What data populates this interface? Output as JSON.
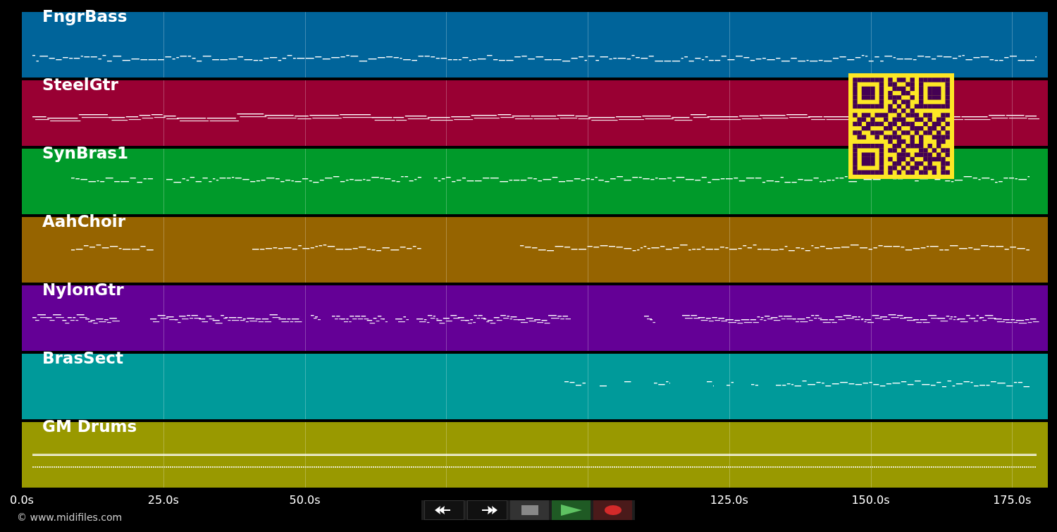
{
  "tracks": [
    {
      "name": "FngrBass",
      "color": "#00649a"
    },
    {
      "name": "SteelGtr",
      "color": "#990033"
    },
    {
      "name": "SynBras1",
      "color": "#009a2a"
    },
    {
      "name": "AahChoir",
      "color": "#966400"
    },
    {
      "name": "NylonGtr",
      "color": "#640096"
    },
    {
      "name": "BrasSect",
      "color": "#009a9a"
    },
    {
      "name": "GM Drums",
      "color": "#999900"
    }
  ],
  "time_axis": [
    "0.0s",
    "25.0s",
    "50.0s",
    "125.0s",
    "150.0s",
    "175.0s"
  ],
  "transport": [
    {
      "kind": "rewind"
    },
    {
      "kind": "fast_forward"
    },
    {
      "kind": "stop"
    },
    {
      "kind": "play"
    },
    {
      "kind": "record"
    }
  ],
  "footer": "© www.midifiles.com"
}
